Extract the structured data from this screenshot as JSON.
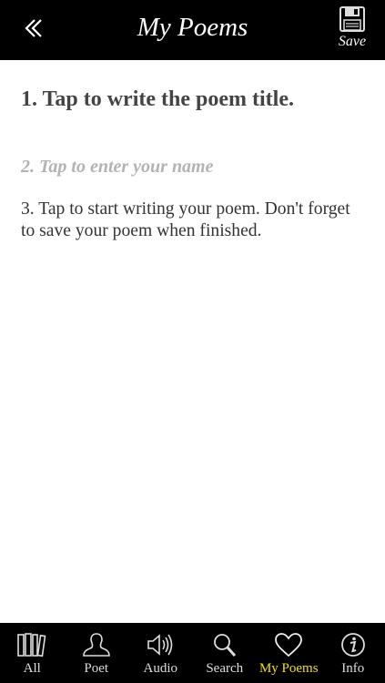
{
  "header": {
    "title": "My Poems",
    "save_label": "Save",
    "back_icon": "double-chevron-left-icon",
    "save_icon": "floppy-disk-icon"
  },
  "editor": {
    "title_placeholder": "1. Tap to write the poem title.",
    "name_placeholder": "2. Tap to enter your name",
    "body_placeholder": "3. Tap to start writing your poem. Don't forget to save your poem when finished."
  },
  "tabbar": {
    "active_color": "#f4e000",
    "tabs": [
      {
        "label": "All",
        "icon": "books-icon"
      },
      {
        "label": "Poet",
        "icon": "person-icon"
      },
      {
        "label": "Audio",
        "icon": "speaker-icon"
      },
      {
        "label": "Search",
        "icon": "magnifier-icon"
      },
      {
        "label": "My Poems",
        "icon": "heart-icon",
        "active": true
      },
      {
        "label": "Info",
        "icon": "info-icon"
      }
    ]
  }
}
